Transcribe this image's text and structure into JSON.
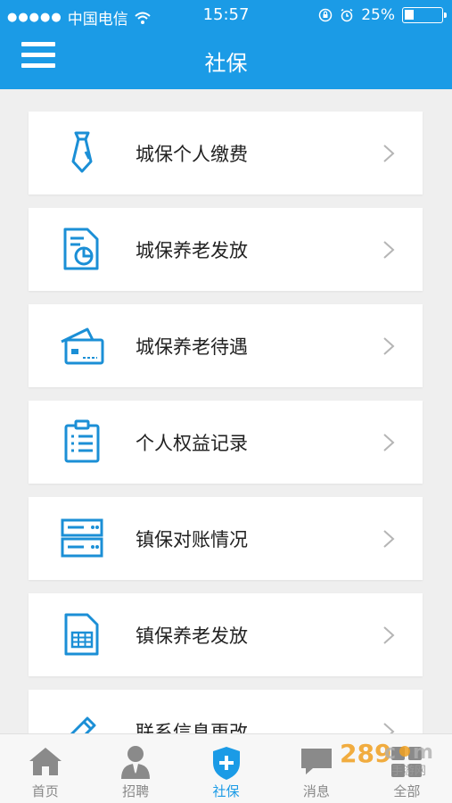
{
  "status_bar": {
    "carrier": "中国电信",
    "time": "15:57",
    "battery": "25%",
    "battery_level": 0.25,
    "icons": [
      "signal-dots-icon",
      "wifi-icon",
      "orientation-lock-icon",
      "alarm-icon",
      "battery-icon"
    ]
  },
  "header": {
    "title": "社保",
    "menu_icon": "hamburger-menu-icon"
  },
  "items": [
    {
      "label": "城保个人缴费",
      "icon": "tie-icon"
    },
    {
      "label": "城保养老发放",
      "icon": "document-chart-icon"
    },
    {
      "label": "城保养老待遇",
      "icon": "cards-icon"
    },
    {
      "label": "个人权益记录",
      "icon": "clipboard-list-icon"
    },
    {
      "label": "镇保对账情况",
      "icon": "server-icon"
    },
    {
      "label": "镇保养老发放",
      "icon": "spreadsheet-icon"
    },
    {
      "label": "联系信息更改",
      "icon": "pen-icon"
    }
  ],
  "tabs": [
    {
      "label": "首页",
      "icon": "home-icon"
    },
    {
      "label": "招聘",
      "icon": "person-icon"
    },
    {
      "label": "社保",
      "icon": "shield-plus-icon",
      "active": true
    },
    {
      "label": "消息",
      "icon": "message-icon"
    },
    {
      "label": "全部",
      "icon": "grid-icon"
    }
  ],
  "watermark": {
    "text": "289",
    "suffix": "手游网"
  },
  "colors": {
    "accent": "#1b9be6",
    "background": "#efefef",
    "icon": "#1b8fd6"
  }
}
